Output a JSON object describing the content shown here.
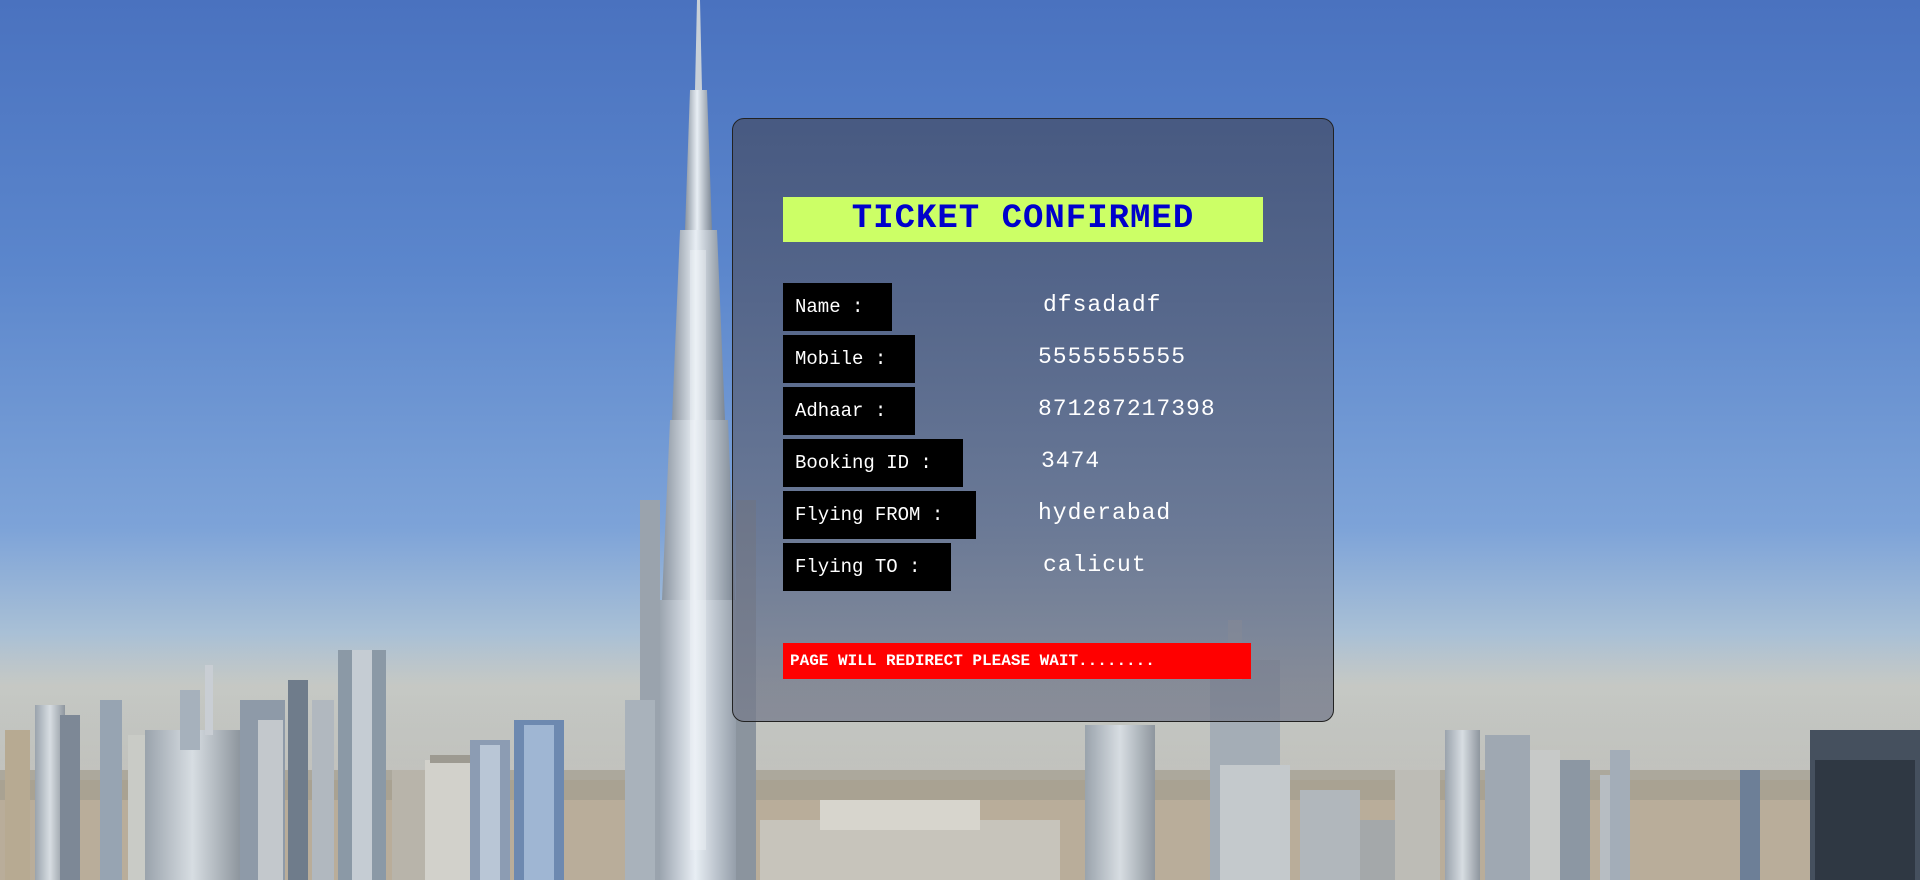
{
  "confirmation": {
    "title": "TICKET CONFIRMED",
    "title_color": "#0000cc",
    "title_background": "#ccff66"
  },
  "details": [
    {
      "label": "Name :",
      "value": "dfsadadf"
    },
    {
      "label": "Mobile :",
      "value": "5555555555"
    },
    {
      "label": "Adhaar :",
      "value": "871287217398"
    },
    {
      "label": "Booking ID :",
      "value": "3474"
    },
    {
      "label": "Flying FROM :",
      "value": "hyderabad"
    },
    {
      "label": "Flying TO :",
      "value": "calicut"
    }
  ],
  "redirect_notice": {
    "text": "PAGE WILL REDIRECT PLEASE WAIT........",
    "background": "#ff0000"
  }
}
